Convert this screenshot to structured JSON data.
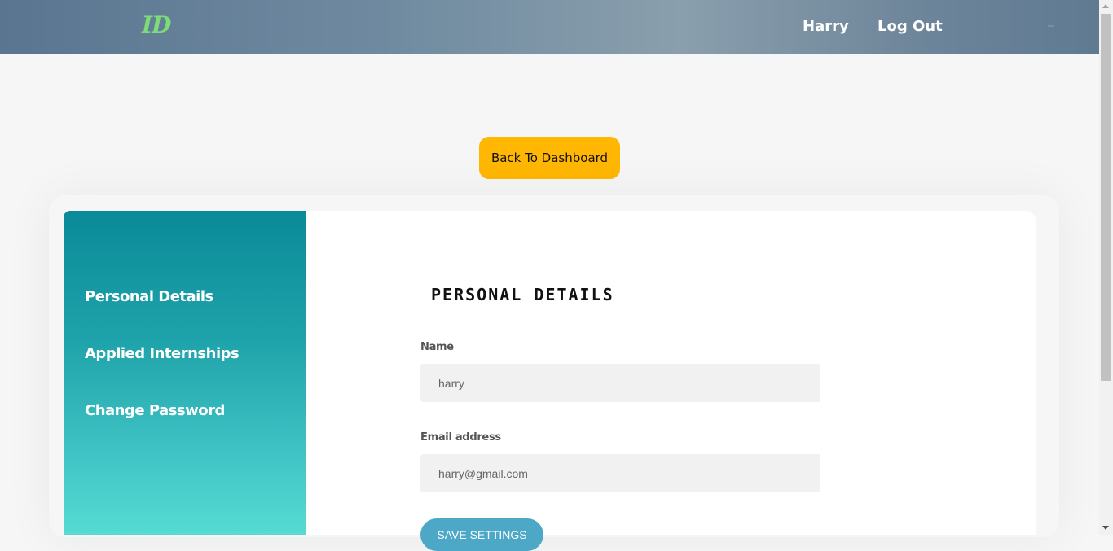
{
  "header": {
    "logo": "ID",
    "user_name": "Harry",
    "logout_label": "Log Out"
  },
  "back_button_label": "Back To Dashboard",
  "sidebar": {
    "items": [
      {
        "label": "Personal Details"
      },
      {
        "label": "Applied Internships"
      },
      {
        "label": "Change Password"
      }
    ]
  },
  "form": {
    "title": "PERSONAL DETAILS",
    "name_label": "Name",
    "name_value": "harry",
    "email_label": "Email address",
    "email_value": "harry@gmail.com",
    "save_label": "SAVE SETTINGS"
  },
  "colors": {
    "accent_button": "#ffb703",
    "logo": "#7ddc7a",
    "sidebar_top": "#0a8a98",
    "sidebar_bottom": "#56dbd3",
    "save_button": "#4da8c7"
  }
}
